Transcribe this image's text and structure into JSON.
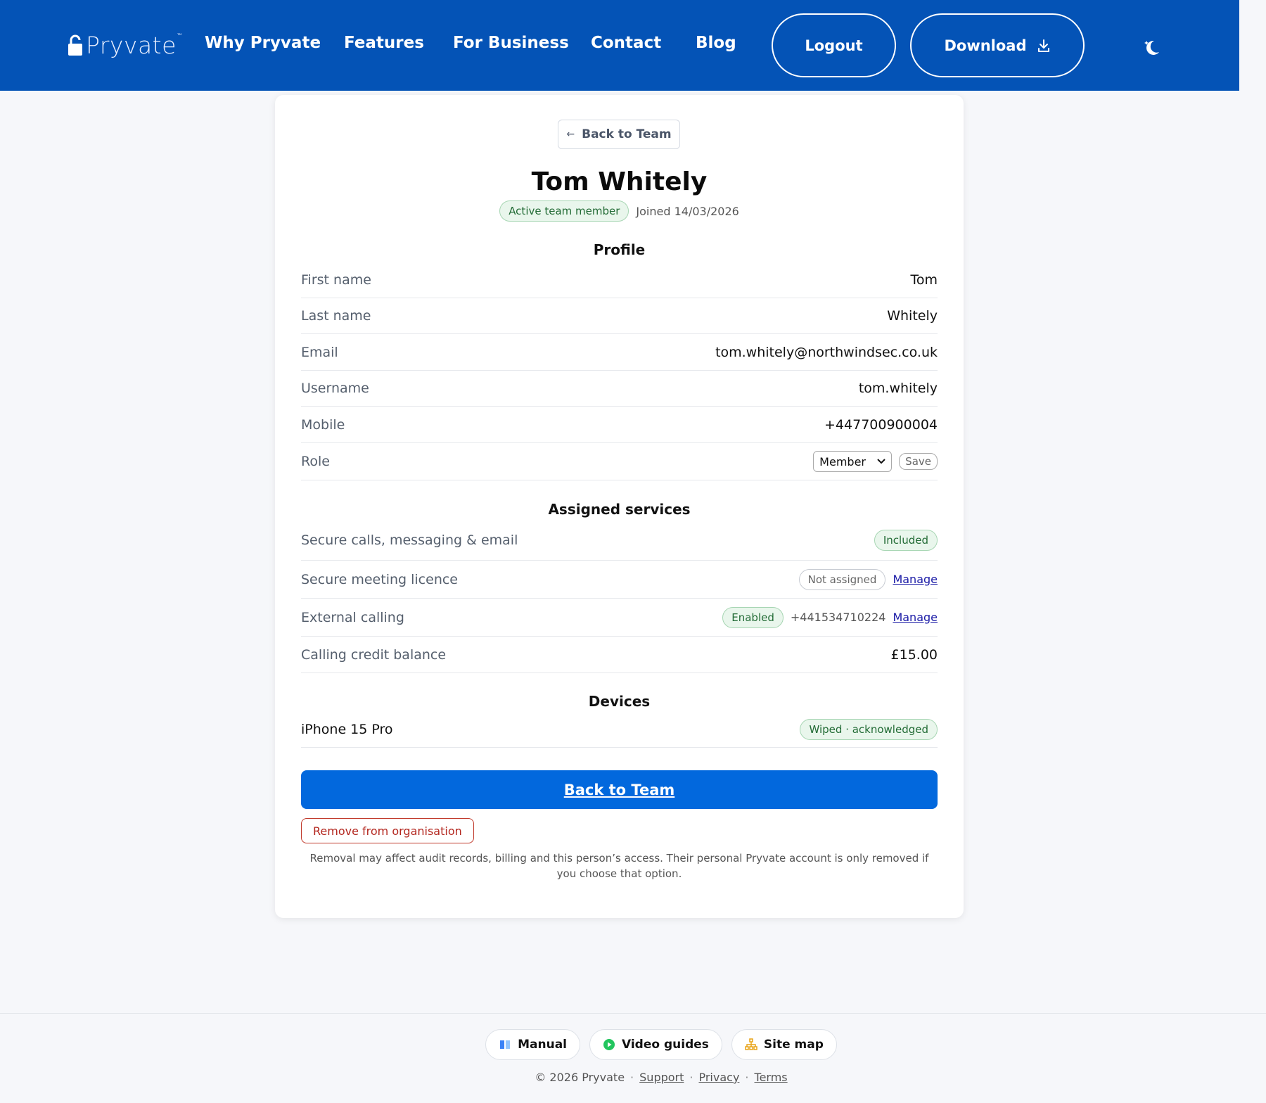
{
  "header": {
    "logo_text": "Pryvate",
    "logo_tm": "™",
    "nav": [
      "Why Pryvate",
      "Features",
      "For Business",
      "Contact",
      "Blog"
    ],
    "logout_label": "Logout",
    "download_label": "Download"
  },
  "back_top_label": "Back to Team",
  "member": {
    "name": "Tom Whitely",
    "status_badge": "Active team member",
    "joined": "Joined 14/03/2026"
  },
  "profile": {
    "title": "Profile",
    "rows": [
      {
        "label": "First name",
        "value": "Tom"
      },
      {
        "label": "Last name",
        "value": "Whitely"
      },
      {
        "label": "Email",
        "value": "tom.whitely@northwindsec.co.uk"
      },
      {
        "label": "Username",
        "value": "tom.whitely"
      },
      {
        "label": "Mobile",
        "value": "+447700900004"
      }
    ],
    "role": {
      "label": "Role",
      "selected": "Member",
      "save_label": "Save"
    }
  },
  "services": {
    "title": "Assigned services",
    "secure_calls": {
      "label": "Secure calls, messaging & email",
      "badge": "Included"
    },
    "meeting": {
      "label": "Secure meeting licence",
      "badge": "Not assigned",
      "link": "Manage"
    },
    "external": {
      "label": "External calling",
      "badge": "Enabled",
      "number": "+441534710224",
      "link": "Manage"
    },
    "credit": {
      "label": "Calling credit balance",
      "value": "£15.00"
    }
  },
  "devices": {
    "title": "Devices",
    "items": [
      {
        "name": "iPhone 15 Pro",
        "badge": "Wiped · acknowledged"
      }
    ]
  },
  "actions": {
    "primary_label": "Back to Team",
    "remove_label": "Remove from organisation",
    "note": "Removal may affect audit records, billing and this person’s access. Their personal Pryvate account is only removed if you choose that option."
  },
  "footer": {
    "pills": [
      "Manual",
      "Video guides",
      "Site map"
    ],
    "copyright": "© 2026 Pryvate",
    "links": [
      "Support",
      "Privacy",
      "Terms"
    ]
  },
  "colors": {
    "header_bg": "#0453b6",
    "primary": "#0268dd",
    "badge_green": "#226b35",
    "danger": "#b3261e"
  }
}
